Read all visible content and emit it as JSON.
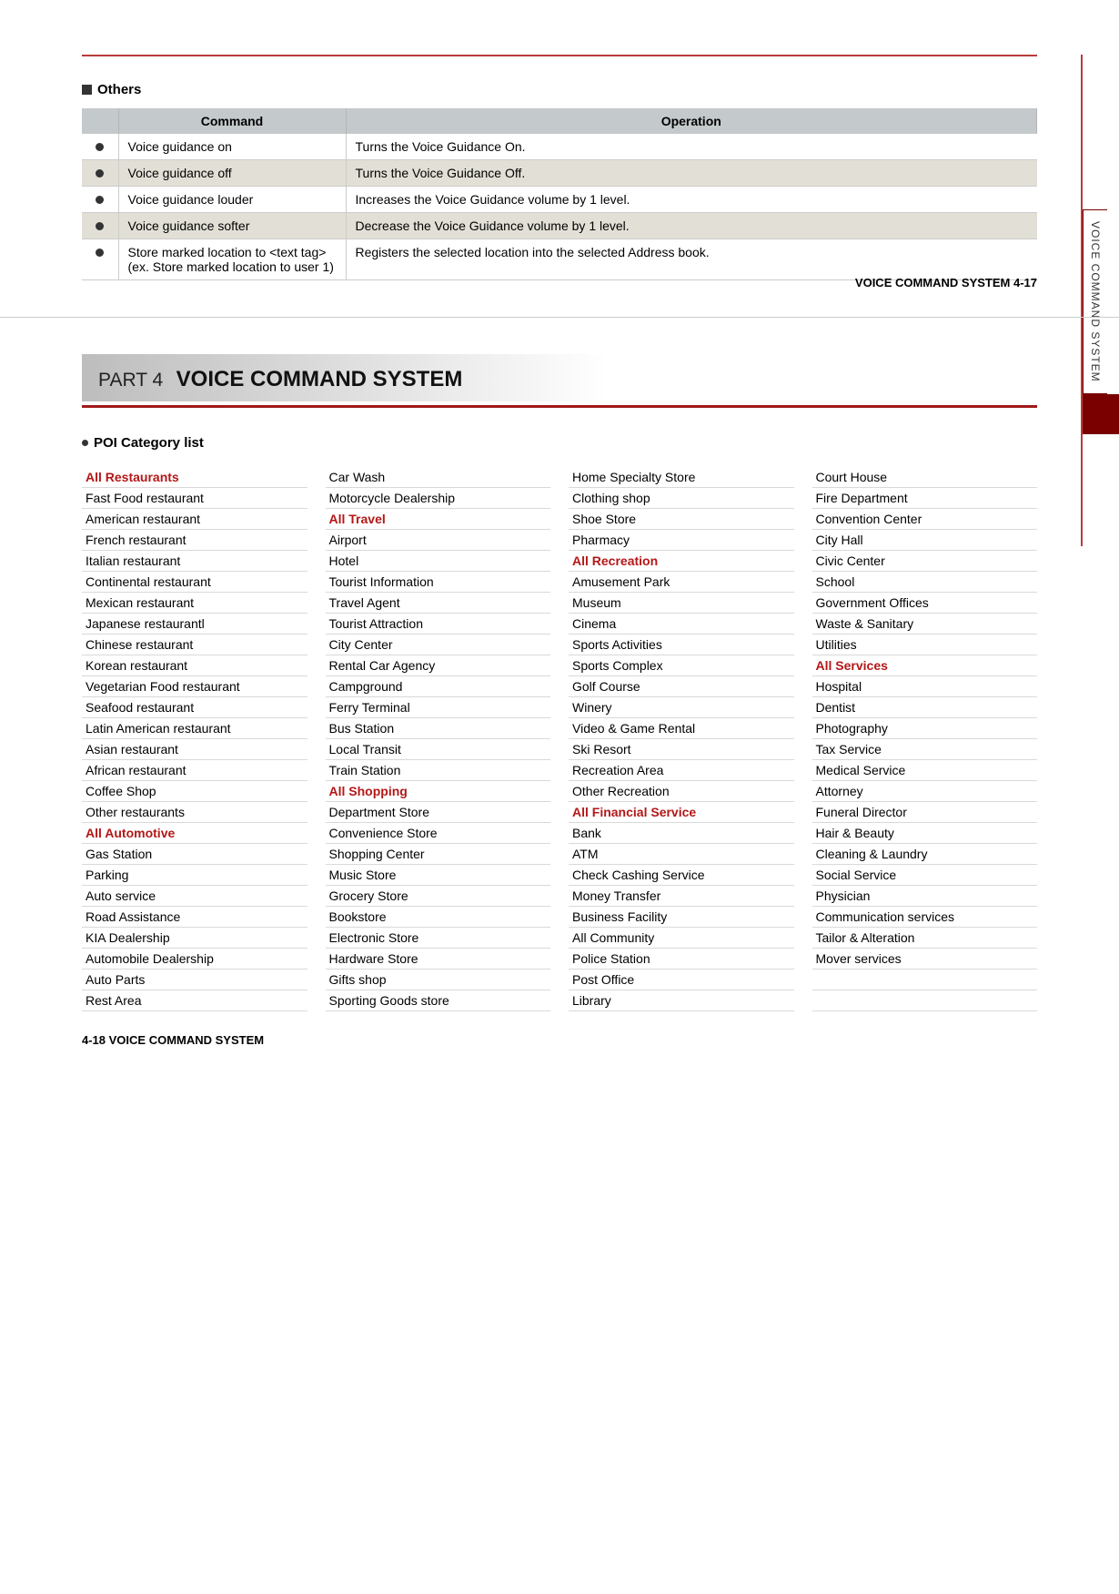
{
  "page1": {
    "section_title": "Others",
    "table": {
      "headers": {
        "col1": "",
        "col2": "Command",
        "col3": "Operation"
      },
      "rows": [
        {
          "shade": false,
          "command": "Voice guidance on",
          "operation": "Turns the Voice Guidance On."
        },
        {
          "shade": true,
          "command": "Voice guidance off",
          "operation": "Turns the Voice Guidance Off."
        },
        {
          "shade": false,
          "command": "Voice guidance louder",
          "operation": "Increases the Voice Guidance volume by 1 level."
        },
        {
          "shade": true,
          "command": "Voice guidance softer",
          "operation": "Decrease the Voice Guidance volume by 1 level."
        },
        {
          "shade": false,
          "command": "Store marked location to <text tag> (ex. Store marked location to user 1)",
          "operation": "Registers the selected location into the selected Address book."
        }
      ]
    },
    "side_tab": "VOICE COMMAND SYSTEM",
    "footer": "VOICE COMMAND SYSTEM   4-17"
  },
  "page2": {
    "part_label": "PART 4",
    "part_title": "VOICE COMMAND SYSTEM",
    "poi_heading": "POI Category list",
    "columns": [
      [
        {
          "t": "All Restaurants",
          "h": true
        },
        {
          "t": "Fast Food restaurant"
        },
        {
          "t": "American restaurant"
        },
        {
          "t": "French restaurant"
        },
        {
          "t": "Italian restaurant"
        },
        {
          "t": "Continental restaurant"
        },
        {
          "t": "Mexican restaurant"
        },
        {
          "t": "Japanese restaurantl"
        },
        {
          "t": "Chinese restaurant"
        },
        {
          "t": "Korean restaurant"
        },
        {
          "t": "Vegetarian Food restaurant"
        },
        {
          "t": "Seafood restaurant"
        },
        {
          "t": "Latin American restaurant"
        },
        {
          "t": "Asian restaurant"
        },
        {
          "t": "African restaurant"
        },
        {
          "t": "Coffee Shop"
        },
        {
          "t": "Other restaurants"
        },
        {
          "t": "All Automotive",
          "h": true
        },
        {
          "t": "Gas Station"
        },
        {
          "t": "Parking"
        },
        {
          "t": "Auto service"
        },
        {
          "t": "Road Assistance"
        },
        {
          "t": "KIA Dealership"
        },
        {
          "t": "Automobile Dealership"
        },
        {
          "t": "Auto Parts"
        },
        {
          "t": "Rest Area"
        }
      ],
      [
        {
          "t": "Car Wash"
        },
        {
          "t": "Motorcycle Dealership"
        },
        {
          "t": "All Travel",
          "h": true
        },
        {
          "t": "Airport"
        },
        {
          "t": "Hotel"
        },
        {
          "t": "Tourist Information"
        },
        {
          "t": "Travel Agent"
        },
        {
          "t": "Tourist Attraction"
        },
        {
          "t": "City Center"
        },
        {
          "t": "Rental Car Agency"
        },
        {
          "t": "Campground"
        },
        {
          "t": "Ferry Terminal"
        },
        {
          "t": "Bus Station"
        },
        {
          "t": "Local Transit"
        },
        {
          "t": "Train Station"
        },
        {
          "t": "All Shopping",
          "h": true
        },
        {
          "t": "Department Store"
        },
        {
          "t": "Convenience Store"
        },
        {
          "t": "Shopping Center"
        },
        {
          "t": "Music Store"
        },
        {
          "t": "Grocery Store"
        },
        {
          "t": "Bookstore"
        },
        {
          "t": "Electronic Store"
        },
        {
          "t": "Hardware Store"
        },
        {
          "t": "Gifts shop"
        },
        {
          "t": "Sporting Goods store"
        }
      ],
      [
        {
          "t": "Home Specialty Store"
        },
        {
          "t": "Clothing shop"
        },
        {
          "t": "Shoe Store"
        },
        {
          "t": "Pharmacy"
        },
        {
          "t": "All Recreation",
          "h": true
        },
        {
          "t": "Amusement Park"
        },
        {
          "t": "Museum"
        },
        {
          "t": "Cinema"
        },
        {
          "t": "Sports Activities"
        },
        {
          "t": "Sports Complex"
        },
        {
          "t": "Golf Course"
        },
        {
          "t": "Winery"
        },
        {
          "t": "Video & Game Rental"
        },
        {
          "t": "Ski Resort"
        },
        {
          "t": "Recreation Area"
        },
        {
          "t": "Other Recreation"
        },
        {
          "t": "All Financial Service",
          "h": true
        },
        {
          "t": "Bank"
        },
        {
          "t": "ATM"
        },
        {
          "t": "Check Cashing Service"
        },
        {
          "t": "Money Transfer"
        },
        {
          "t": "Business Facility"
        },
        {
          "t": "All Community"
        },
        {
          "t": "Police Station"
        },
        {
          "t": "Post Office"
        },
        {
          "t": "Library"
        }
      ],
      [
        {
          "t": "Court House"
        },
        {
          "t": "Fire Department"
        },
        {
          "t": "Convention Center"
        },
        {
          "t": "City Hall"
        },
        {
          "t": "Civic Center"
        },
        {
          "t": "School"
        },
        {
          "t": "Government Offices"
        },
        {
          "t": "Waste & Sanitary"
        },
        {
          "t": "Utilities"
        },
        {
          "t": "All Services",
          "h": true
        },
        {
          "t": "Hospital"
        },
        {
          "t": "Dentist"
        },
        {
          "t": "Photography"
        },
        {
          "t": "Tax Service"
        },
        {
          "t": "Medical Service"
        },
        {
          "t": "Attorney"
        },
        {
          "t": "Funeral Director"
        },
        {
          "t": "Hair & Beauty"
        },
        {
          "t": "Cleaning & Laundry"
        },
        {
          "t": "Social Service"
        },
        {
          "t": "Physician"
        },
        {
          "t": "Communication services"
        },
        {
          "t": "Tailor & Alteration"
        },
        {
          "t": "Mover services"
        },
        {
          "t": " "
        },
        {
          "t": " "
        }
      ]
    ],
    "footer": "4-18   VOICE COMMAND SYSTEM"
  }
}
